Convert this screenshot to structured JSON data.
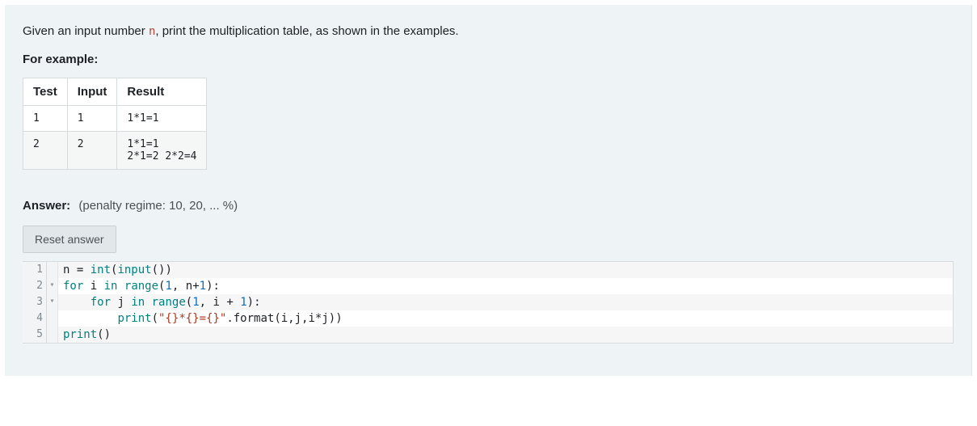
{
  "prompt": {
    "before_var": "Given an input number ",
    "var": "n",
    "after_var": ", print the multiplication table, as shown in the examples."
  },
  "for_example_label": "For example:",
  "table": {
    "headers": [
      "Test",
      "Input",
      "Result"
    ],
    "rows": [
      {
        "test": "1",
        "input": "1",
        "result": "1*1=1"
      },
      {
        "test": "2",
        "input": "2",
        "result": "1*1=1\n2*1=2 2*2=4"
      }
    ]
  },
  "answer": {
    "label": "Answer:",
    "penalty": "(penalty regime: 10, 20, ... %)"
  },
  "reset_label": "Reset answer",
  "code": {
    "lines": [
      {
        "num": "1",
        "fold": "",
        "tokens": [
          {
            "t": "n ",
            "c": "ident"
          },
          {
            "t": "= ",
            "c": "punc"
          },
          {
            "t": "int",
            "c": "builtin"
          },
          {
            "t": "(",
            "c": "punc"
          },
          {
            "t": "input",
            "c": "builtin"
          },
          {
            "t": "())",
            "c": "punc"
          }
        ]
      },
      {
        "num": "2",
        "fold": "▾",
        "tokens": [
          {
            "t": "for",
            "c": "kw"
          },
          {
            "t": " i ",
            "c": "ident"
          },
          {
            "t": "in",
            "c": "kw"
          },
          {
            "t": " ",
            "c": "ident"
          },
          {
            "t": "range",
            "c": "builtin"
          },
          {
            "t": "(",
            "c": "punc"
          },
          {
            "t": "1",
            "c": "num"
          },
          {
            "t": ", n+",
            "c": "ident"
          },
          {
            "t": "1",
            "c": "num"
          },
          {
            "t": "):",
            "c": "punc"
          }
        ]
      },
      {
        "num": "3",
        "fold": "▾",
        "tokens": [
          {
            "t": "    ",
            "c": "ident"
          },
          {
            "t": "for",
            "c": "kw"
          },
          {
            "t": " j ",
            "c": "ident"
          },
          {
            "t": "in",
            "c": "kw"
          },
          {
            "t": " ",
            "c": "ident"
          },
          {
            "t": "range",
            "c": "builtin"
          },
          {
            "t": "(",
            "c": "punc"
          },
          {
            "t": "1",
            "c": "num"
          },
          {
            "t": ", i + ",
            "c": "ident"
          },
          {
            "t": "1",
            "c": "num"
          },
          {
            "t": "):",
            "c": "punc"
          }
        ]
      },
      {
        "num": "4",
        "fold": "",
        "tokens": [
          {
            "t": "        ",
            "c": "ident"
          },
          {
            "t": "print",
            "c": "builtin"
          },
          {
            "t": "(",
            "c": "punc"
          },
          {
            "t": "\"{}*{}={}\"",
            "c": "str"
          },
          {
            "t": ".format(i,j,i*j))",
            "c": "punc"
          }
        ]
      },
      {
        "num": "5",
        "fold": "",
        "tokens": [
          {
            "t": "print",
            "c": "builtin"
          },
          {
            "t": "()",
            "c": "punc"
          }
        ]
      }
    ]
  }
}
